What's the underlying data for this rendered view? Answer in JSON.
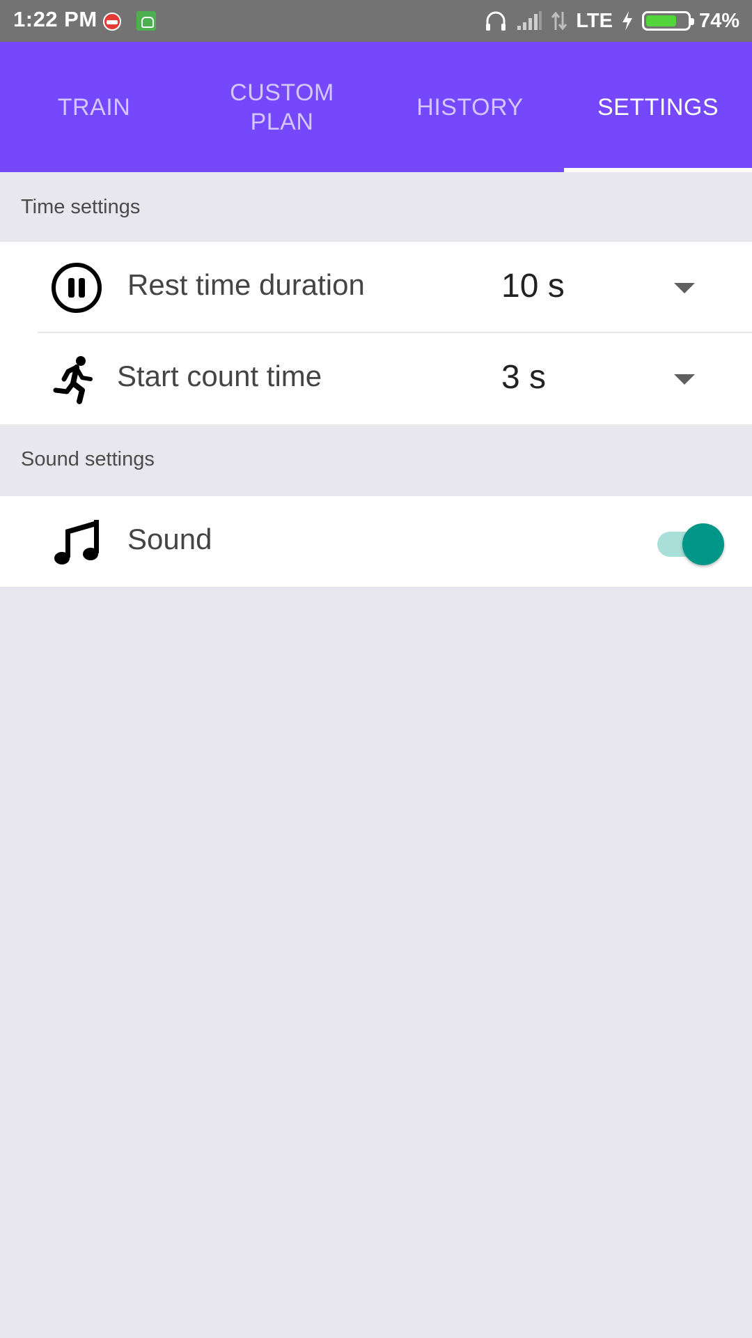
{
  "status_bar": {
    "time": "1:22 PM",
    "network": "LTE",
    "battery_percent": "74%",
    "battery_level": 0.74
  },
  "tabs": [
    {
      "label": "TRAIN",
      "active": false
    },
    {
      "label": "CUSTOM\nPLAN",
      "active": false
    },
    {
      "label": "HISTORY",
      "active": false
    },
    {
      "label": "SETTINGS",
      "active": true
    }
  ],
  "time_settings": {
    "header": "Time settings",
    "rest_time": {
      "label": "Rest time duration",
      "value": "10 s",
      "icon": "pause-circle-icon"
    },
    "start_count": {
      "label": "Start count time",
      "value": "3 s",
      "icon": "running-person-icon"
    }
  },
  "sound_settings": {
    "header": "Sound settings",
    "sound": {
      "label": "Sound",
      "enabled": true,
      "icon": "music-note-icon"
    }
  },
  "colors": {
    "accent": "#7548fd",
    "toggle_on": "#009688",
    "background": "#e8e7ee"
  }
}
